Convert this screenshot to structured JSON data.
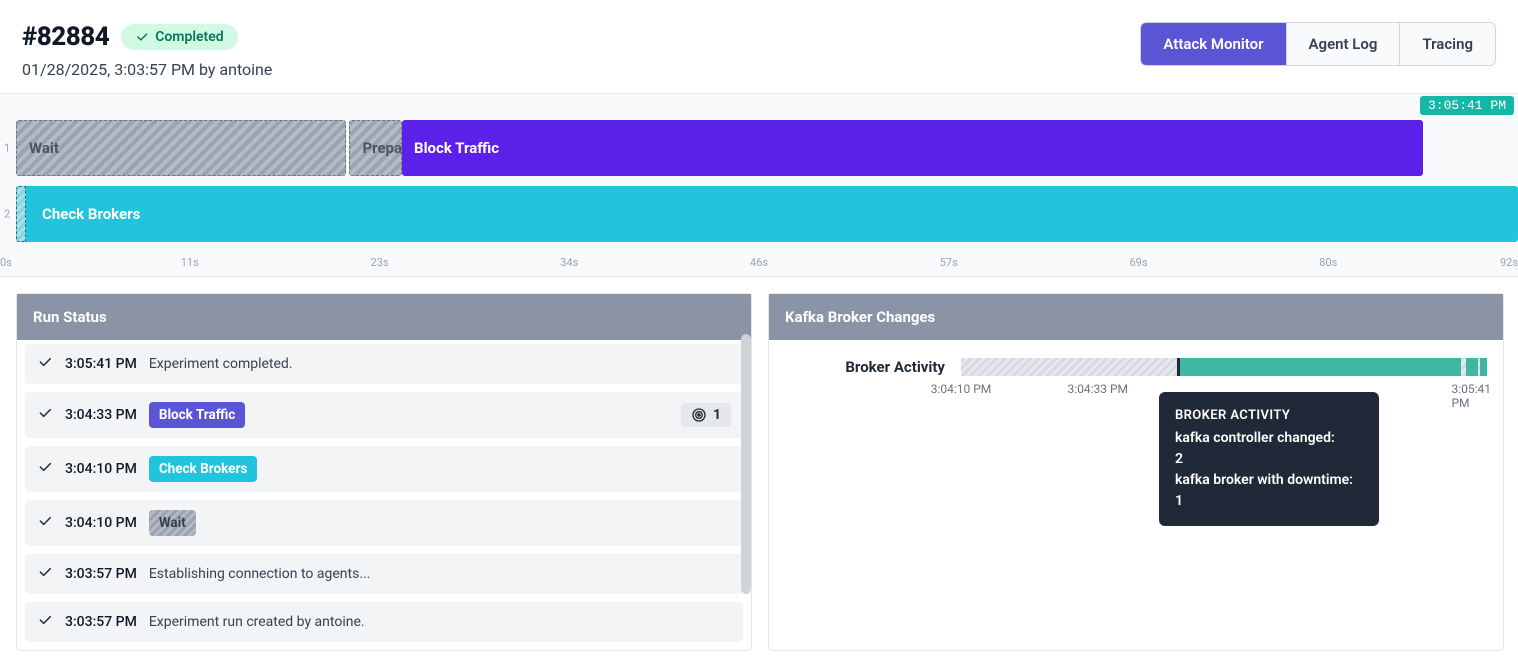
{
  "header": {
    "run_id": "#82884",
    "status_label": "Completed",
    "subtitle": "01/28/2025, 3:03:57 PM by antoine"
  },
  "tabs": {
    "attack_monitor": "Attack Monitor",
    "agent_log": "Agent Log",
    "tracing": "Tracing"
  },
  "timeline": {
    "current_time": "3:05:41 PM",
    "lanes": [
      {
        "num": "1",
        "bars": [
          {
            "label": "Wait",
            "style": "hatch-gray",
            "left_pct": 0.0,
            "width_pct": 22.0
          },
          {
            "label": "Prepar",
            "style": "hatch-gray",
            "left_pct": 22.2,
            "width_pct": 3.5
          },
          {
            "label": "Block Traffic",
            "style": "bar-purple",
            "left_pct": 25.7,
            "width_pct": 68.0
          }
        ]
      },
      {
        "num": "2",
        "bars": [
          {
            "label": "Check Brokers",
            "style": "bar-cyan",
            "left_pct": 0.0,
            "width_pct": 100.0,
            "leading_edge": true
          }
        ]
      }
    ],
    "ticks": [
      "0s",
      "11s",
      "23s",
      "34s",
      "46s",
      "57s",
      "69s",
      "80s",
      "92s"
    ]
  },
  "panels": {
    "run_status_title": "Run Status",
    "kafka_title": "Kafka Broker Changes"
  },
  "run_status": [
    {
      "time": "3:05:41 PM",
      "text": "Experiment completed."
    },
    {
      "time": "3:04:33 PM",
      "pill": "Block Traffic",
      "pill_style": "pill-purple",
      "count": "1"
    },
    {
      "time": "3:04:10 PM",
      "pill": "Check Brokers",
      "pill_style": "pill-cyan"
    },
    {
      "time": "3:04:10 PM",
      "pill": "Wait",
      "pill_style": "pill-gray"
    },
    {
      "time": "3:03:57 PM",
      "text": "Establishing connection to agents..."
    },
    {
      "time": "3:03:57 PM",
      "text": "Experiment run created by antoine."
    }
  ],
  "kafka": {
    "row_label": "Broker Activity",
    "ticks": [
      "3:04:10 PM",
      "3:04:33 PM",
      "3:05:41 PM"
    ],
    "tooltip": {
      "title": "BROKER ACTIVITY",
      "line1": "kafka controller changed:",
      "val1": "2",
      "line2": "kafka broker with downtime:",
      "val2": "1"
    }
  }
}
